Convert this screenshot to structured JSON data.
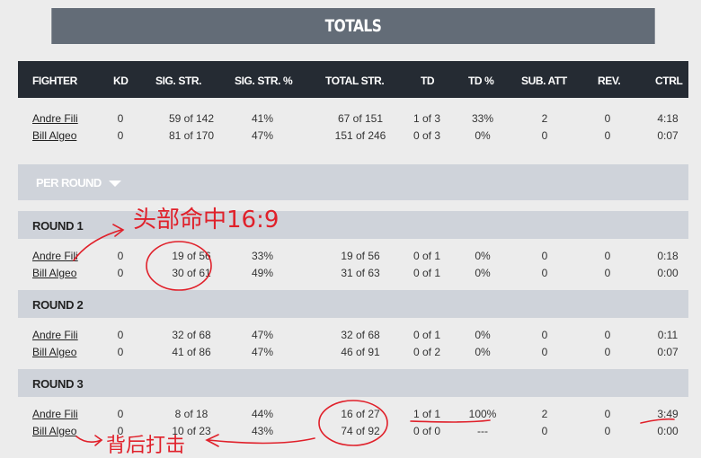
{
  "totals": {
    "title": "TOTALS",
    "columns": [
      "FIGHTER",
      "KD",
      "SIG. STR.",
      "SIG. STR. %",
      "TOTAL STR.",
      "TD",
      "TD %",
      "SUB. ATT",
      "REV.",
      "CTRL"
    ],
    "rows": [
      [
        "Andre Fili",
        "0",
        "59 of 142",
        "41%",
        "67 of 151",
        "1 of 3",
        "33%",
        "2",
        "0",
        "4:18"
      ],
      [
        "Bill Algeo",
        "0",
        "81 of 170",
        "47%",
        "151 of 246",
        "0 of 3",
        "0%",
        "0",
        "0",
        "0:07"
      ]
    ]
  },
  "per_round": {
    "label": "PER ROUND",
    "toggle_icon": "caret-down-icon",
    "rounds": [
      {
        "label": "ROUND 1",
        "rows": [
          [
            "Andre Fili",
            "0",
            "19 of 56",
            "33%",
            "19 of 56",
            "0 of 1",
            "0%",
            "0",
            "0",
            "0:18"
          ],
          [
            "Bill Algeo",
            "0",
            "30 of 61",
            "49%",
            "31 of 63",
            "0 of 1",
            "0%",
            "0",
            "0",
            "0:00"
          ]
        ]
      },
      {
        "label": "ROUND 2",
        "rows": [
          [
            "Andre Fili",
            "0",
            "32 of 68",
            "47%",
            "32 of 68",
            "0 of 1",
            "0%",
            "0",
            "0",
            "0:11"
          ],
          [
            "Bill Algeo",
            "0",
            "41 of 86",
            "47%",
            "46 of 91",
            "0 of 2",
            "0%",
            "0",
            "0",
            "0:07"
          ]
        ]
      },
      {
        "label": "ROUND 3",
        "rows": [
          [
            "Andre Fili",
            "0",
            "8 of 18",
            "44%",
            "16 of 27",
            "1 of 1",
            "100%",
            "2",
            "0",
            "3:49"
          ],
          [
            "Bill Algeo",
            "0",
            "10 of 23",
            "43%",
            "74 of 92",
            "0 of 0",
            "---",
            "0",
            "0",
            "0:00"
          ]
        ]
      }
    ]
  },
  "annotations": {
    "head_strikes_note": "头部命中16:9",
    "back_strikes_note": "背后打击",
    "color": "#e0202a"
  },
  "colors": {
    "banner": "#636c77",
    "header": "#252b33",
    "band": "#cfd3da",
    "background": "#ececec"
  }
}
